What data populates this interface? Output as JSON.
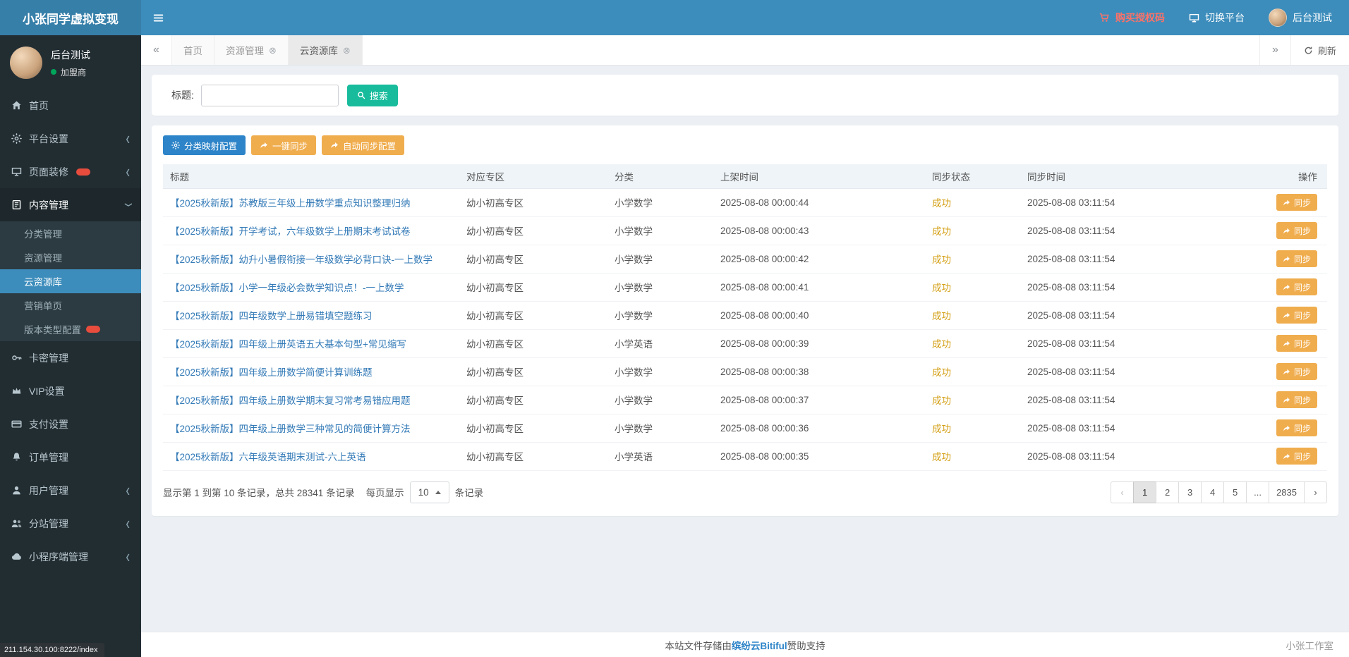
{
  "topbar": {
    "brand": "小张同学虚拟变现",
    "buy_auth": "购买授权码",
    "switch_platform": "切换平台",
    "user_name": "后台测试"
  },
  "sidebar": {
    "user_name": "后台测试",
    "user_status": "加盟商",
    "chevron_glyph": "‹",
    "items": [
      {
        "id": "home",
        "icon": "home",
        "label": "首页"
      },
      {
        "id": "platform-settings",
        "icon": "gear",
        "label": "平台设置",
        "chevron": true
      },
      {
        "id": "page-decoration",
        "icon": "desktop",
        "label": "页面装修",
        "badge": true,
        "chevron": true
      },
      {
        "id": "content-management",
        "icon": "book",
        "label": "内容管理",
        "chevron": true,
        "open": true,
        "children": [
          {
            "id": "category-management",
            "label": "分类管理"
          },
          {
            "id": "resource-management",
            "label": "资源管理"
          },
          {
            "id": "cloud-resource-library",
            "label": "云资源库",
            "active": true
          },
          {
            "id": "marketing-page",
            "label": "营销单页"
          },
          {
            "id": "version-type-config",
            "label": "版本类型配置",
            "badge": true
          }
        ]
      },
      {
        "id": "card-key-management",
        "icon": "key",
        "label": "卡密管理"
      },
      {
        "id": "vip-settings",
        "icon": "vip",
        "label": "VIP设置"
      },
      {
        "id": "payment-settings",
        "icon": "card",
        "label": "支付设置"
      },
      {
        "id": "order-management",
        "icon": "bell",
        "label": "订单管理"
      },
      {
        "id": "user-management",
        "icon": "user",
        "label": "用户管理",
        "chevron": true
      },
      {
        "id": "substation-management",
        "icon": "users",
        "label": "分站管理",
        "chevron": true
      },
      {
        "id": "miniprogram-management",
        "icon": "cloud",
        "label": "小程序端管理",
        "chevron": true
      }
    ]
  },
  "status_url": "211.154.30.100:8222/index",
  "tabbar": {
    "scroll_left": "«",
    "scroll_right": "»",
    "close_glyph": "⊗",
    "refresh_label": "刷新",
    "tabs": [
      {
        "id": "home",
        "label": "首页",
        "closable": false
      },
      {
        "id": "resource-management",
        "label": "资源管理",
        "closable": true
      },
      {
        "id": "cloud-resource-library",
        "label": "云资源库",
        "closable": true,
        "active": true
      }
    ]
  },
  "search": {
    "label": "标题:",
    "value": "",
    "button_label": "搜索"
  },
  "toolbar": {
    "buttons": [
      {
        "id": "category-mapping-config",
        "label": "分类映射配置",
        "style": "blue",
        "icon": "gear"
      },
      {
        "id": "one-key-sync",
        "label": "一键同步",
        "style": "orange",
        "icon": "share"
      },
      {
        "id": "auto-sync-config",
        "label": "自动同步配置",
        "style": "orange",
        "icon": "share"
      }
    ]
  },
  "table": {
    "headers": [
      "标题",
      "对应专区",
      "分类",
      "上架时间",
      "同步状态",
      "同步时间",
      "操作"
    ],
    "sync_button_label": "同步",
    "rows": [
      {
        "title": "【2025秋新版】苏教版三年级上册数学重点知识整理归纳",
        "zone": "幼小初高专区",
        "category": "小学数学",
        "shelf_time": "2025-08-08 00:00:44",
        "status": "成功",
        "sync_time": "2025-08-08 03:11:54"
      },
      {
        "title": "【2025秋新版】开学考试，六年级数学上册期末考试试卷",
        "zone": "幼小初高专区",
        "category": "小学数学",
        "shelf_time": "2025-08-08 00:00:43",
        "status": "成功",
        "sync_time": "2025-08-08 03:11:54"
      },
      {
        "title": "【2025秋新版】幼升小暑假衔接一年级数学必背口诀-一上数学",
        "zone": "幼小初高专区",
        "category": "小学数学",
        "shelf_time": "2025-08-08 00:00:42",
        "status": "成功",
        "sync_time": "2025-08-08 03:11:54"
      },
      {
        "title": "【2025秋新版】小学一年级必会数学知识点！-一上数学",
        "zone": "幼小初高专区",
        "category": "小学数学",
        "shelf_time": "2025-08-08 00:00:41",
        "status": "成功",
        "sync_time": "2025-08-08 03:11:54"
      },
      {
        "title": "【2025秋新版】四年级数学上册易错填空题练习",
        "zone": "幼小初高专区",
        "category": "小学数学",
        "shelf_time": "2025-08-08 00:00:40",
        "status": "成功",
        "sync_time": "2025-08-08 03:11:54"
      },
      {
        "title": "【2025秋新版】四年级上册英语五大基本句型+常见缩写",
        "zone": "幼小初高专区",
        "category": "小学英语",
        "shelf_time": "2025-08-08 00:00:39",
        "status": "成功",
        "sync_time": "2025-08-08 03:11:54"
      },
      {
        "title": "【2025秋新版】四年级上册数学简便计算训练题",
        "zone": "幼小初高专区",
        "category": "小学数学",
        "shelf_time": "2025-08-08 00:00:38",
        "status": "成功",
        "sync_time": "2025-08-08 03:11:54"
      },
      {
        "title": "【2025秋新版】四年级上册数学期末复习常考易错应用题",
        "zone": "幼小初高专区",
        "category": "小学数学",
        "shelf_time": "2025-08-08 00:00:37",
        "status": "成功",
        "sync_time": "2025-08-08 03:11:54"
      },
      {
        "title": "【2025秋新版】四年级上册数学三种常见的简便计算方法",
        "zone": "幼小初高专区",
        "category": "小学数学",
        "shelf_time": "2025-08-08 00:00:36",
        "status": "成功",
        "sync_time": "2025-08-08 03:11:54"
      },
      {
        "title": "【2025秋新版】六年级英语期末测试-六上英语",
        "zone": "幼小初高专区",
        "category": "小学英语",
        "shelf_time": "2025-08-08 00:00:35",
        "status": "成功",
        "sync_time": "2025-08-08 03:11:54"
      }
    ]
  },
  "table_footer": {
    "info": "显示第 1 到第 10 条记录，总共 28341 条记录",
    "per_page_label": "每页显示",
    "per_page": "10",
    "suffix": "条记录"
  },
  "pagination": {
    "prev": "‹",
    "next": "›",
    "pages": [
      "1",
      "2",
      "3",
      "4",
      "5",
      "...",
      "2835"
    ],
    "active_page": "1"
  },
  "footer": {
    "pre": "本站文件存储由",
    "link": "缤纷云Bitiful",
    "post": "赞助支持",
    "studio": "小张工作室"
  },
  "colors": {
    "topbar_blue": "#3c8dbc",
    "brand_blue": "#367fa9",
    "sidebar_dark": "#222d32",
    "submenu_dark": "#2c3b41",
    "active_blue": "#3c8dbc",
    "primary_button_blue": "#2d84c8",
    "orange": "#f0ad4e",
    "search_green": "#18bc9c",
    "link_blue": "#337ab7",
    "status_success_yellow": "#d4a017",
    "badge_red": "#e84c3d",
    "buy_red": "#ff7166",
    "online_green": "#00a65a"
  },
  "icons": {
    "home": "svg",
    "gear": "svg",
    "desktop": "svg",
    "book": "svg",
    "key": "svg",
    "vip": "svg",
    "card": "svg",
    "bell": "svg",
    "user": "svg",
    "users": "svg",
    "cloud": "svg",
    "cart": "svg",
    "monitor": "svg",
    "search": "svg",
    "share": "svg",
    "refresh": "svg",
    "bars": "svg",
    "chevron": "‹",
    "close_tab": "⊗",
    "scroll_left": "«",
    "scroll_right": "»"
  }
}
